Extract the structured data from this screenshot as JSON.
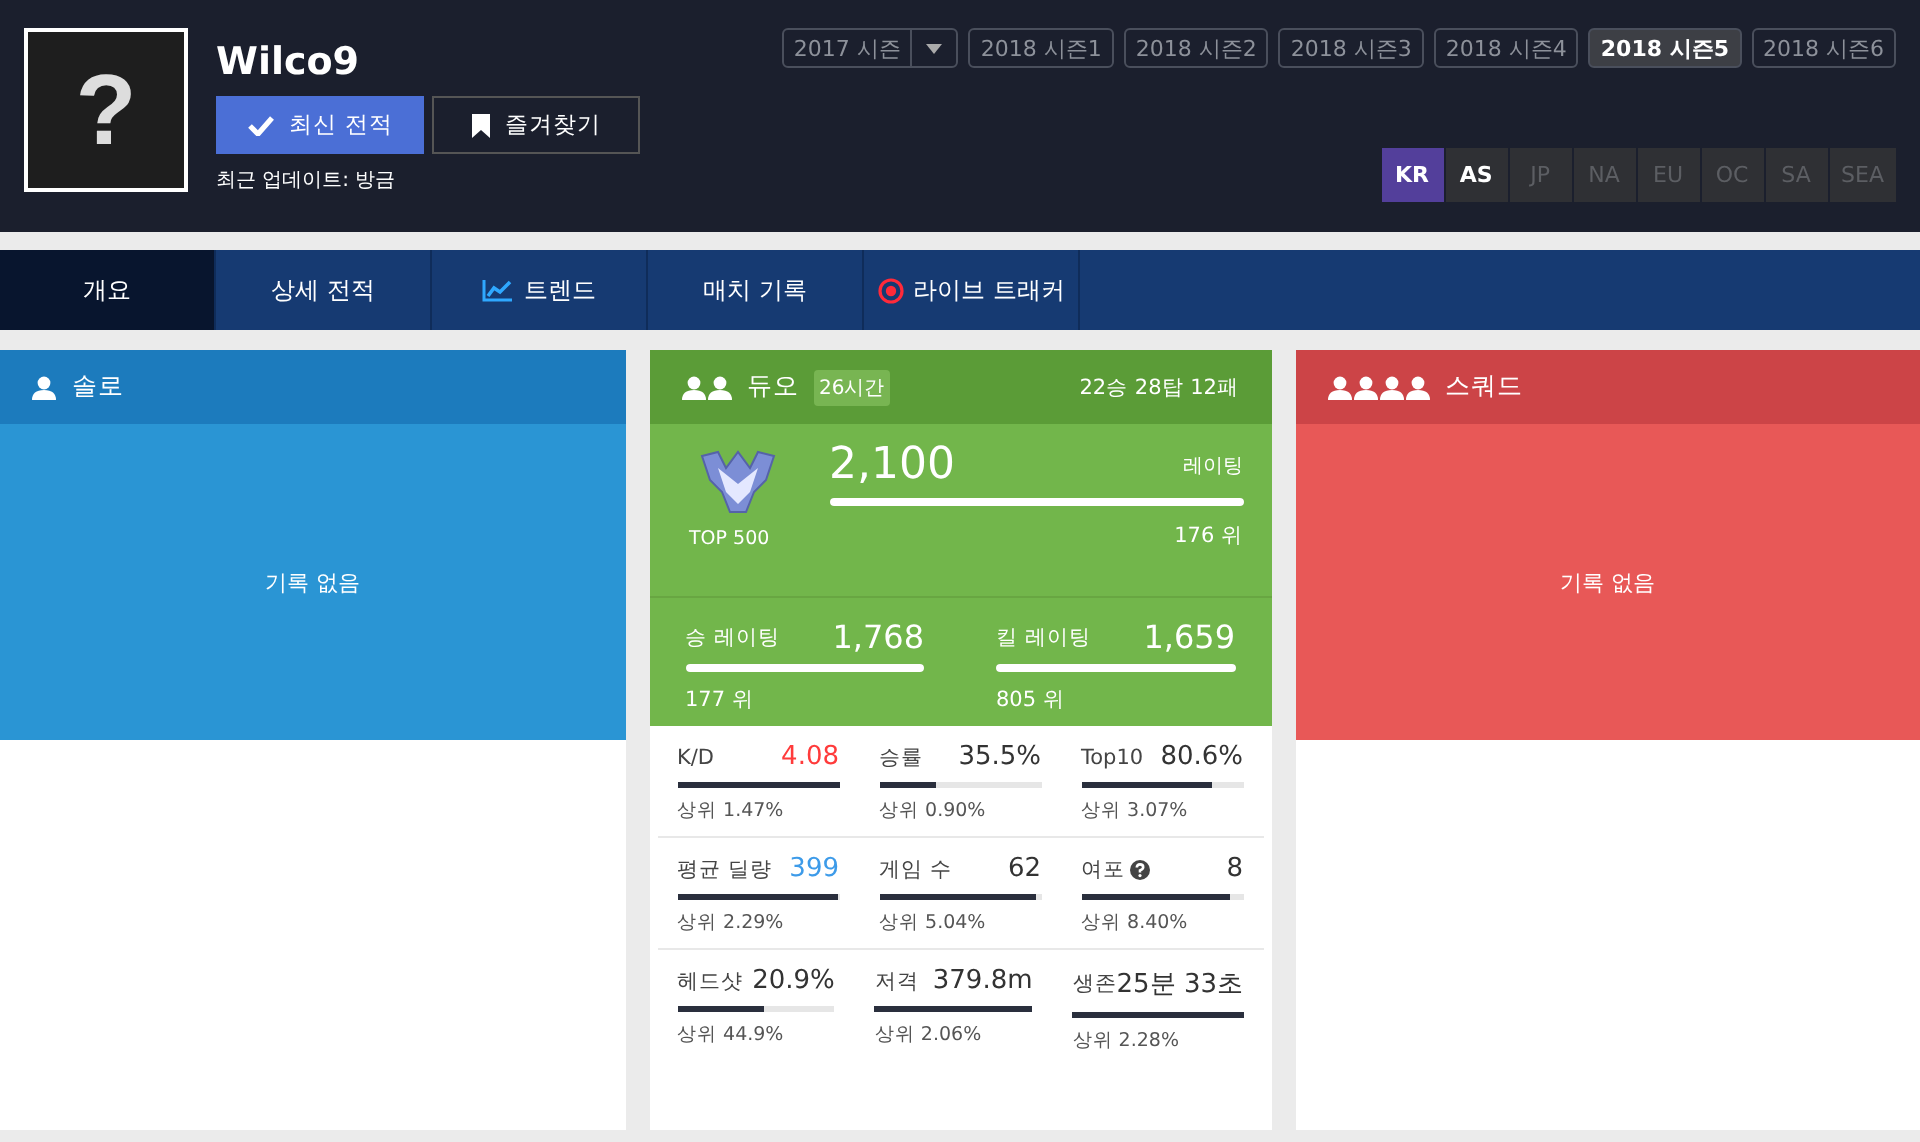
{
  "profile": {
    "avatar": "?",
    "name": "Wilco9",
    "refresh_button": "최신 전적",
    "favorite_button": "즐겨찾기",
    "last_update": "최근 업데이트: 방금"
  },
  "seasons": [
    {
      "label": "2017 시즌",
      "kind": "dropdown",
      "selected": false
    },
    {
      "label": "2018 시즌1",
      "kind": "plain",
      "selected": false
    },
    {
      "label": "2018 시즌2",
      "kind": "plain",
      "selected": false
    },
    {
      "label": "2018 시즌3",
      "kind": "plain",
      "selected": false
    },
    {
      "label": "2018 시즌4",
      "kind": "plain",
      "selected": false
    },
    {
      "label": "2018 시즌5",
      "kind": "plain",
      "selected": true
    },
    {
      "label": "2018 시즌6",
      "kind": "plain",
      "selected": false
    }
  ],
  "regions": [
    {
      "label": "KR",
      "selected": true,
      "disabled": false
    },
    {
      "label": "AS",
      "selected": false,
      "disabled": false
    },
    {
      "label": "JP",
      "selected": false,
      "disabled": true
    },
    {
      "label": "NA",
      "selected": false,
      "disabled": true
    },
    {
      "label": "EU",
      "selected": false,
      "disabled": true
    },
    {
      "label": "OC",
      "selected": false,
      "disabled": true
    },
    {
      "label": "SA",
      "selected": false,
      "disabled": true
    },
    {
      "label": "SEA",
      "selected": false,
      "disabled": true
    }
  ],
  "tabs": [
    {
      "label": "개요",
      "kind": "plain",
      "selected": true
    },
    {
      "label": "상세 전적",
      "kind": "plain",
      "selected": false
    },
    {
      "label": "트렌드",
      "kind": "chart",
      "selected": false
    },
    {
      "label": "매치 기록",
      "kind": "plain",
      "selected": false
    },
    {
      "label": "라이브 트래커",
      "kind": "live",
      "selected": false
    }
  ],
  "solo": {
    "title": "솔로",
    "empty_text": "기록 없음"
  },
  "duo": {
    "title": "듀오",
    "play_time": "26시간",
    "record": "22승 28탑 12패",
    "tier": "TOP 500",
    "rating": "2,100",
    "rating_label": "레이팅",
    "level": 1,
    "rank": "176 위",
    "sub_ratings": [
      {
        "label": "승 레이팅",
        "value": "1,768",
        "level": 1,
        "rank": "177 위"
      },
      {
        "label": "킬 레이팅",
        "value": "1,659",
        "level": 1,
        "rank": "805 위"
      }
    ],
    "stats": [
      {
        "label": "K/D",
        "value": "4.08",
        "color": "#ff3b3b",
        "help": false,
        "level": 1,
        "percentile": "상위 1.47%"
      },
      {
        "label": "승률",
        "value": "35.5%",
        "help": false,
        "level": 0.35,
        "percentile": "상위 0.90%"
      },
      {
        "label": "Top10",
        "value": "80.6%",
        "help": false,
        "level": 0.81,
        "percentile": "상위 3.07%"
      },
      {
        "label": "평균 딜량",
        "value": "399",
        "color": "#3d9be9",
        "help": false,
        "level": 0.99,
        "percentile": "상위 2.29%"
      },
      {
        "label": "게임 수",
        "value": "62",
        "help": false,
        "level": 0.97,
        "percentile": "상위 5.04%"
      },
      {
        "label": "여포",
        "value": "8",
        "help": true,
        "level": 0.92,
        "percentile": "상위 8.40%"
      },
      {
        "label": "헤드샷",
        "value": "20.9%",
        "help": false,
        "level": 0.55,
        "percentile": "상위 44.9%"
      },
      {
        "label": "저격",
        "value": "379.8m",
        "help": false,
        "level": 1,
        "percentile": "상위 2.06%"
      },
      {
        "label": "생존",
        "value": "25분 33초",
        "help": false,
        "level": 1,
        "percentile": "상위 2.28%"
      }
    ]
  },
  "squad": {
    "title": "스쿼드",
    "empty_text": "기록 없음"
  }
}
